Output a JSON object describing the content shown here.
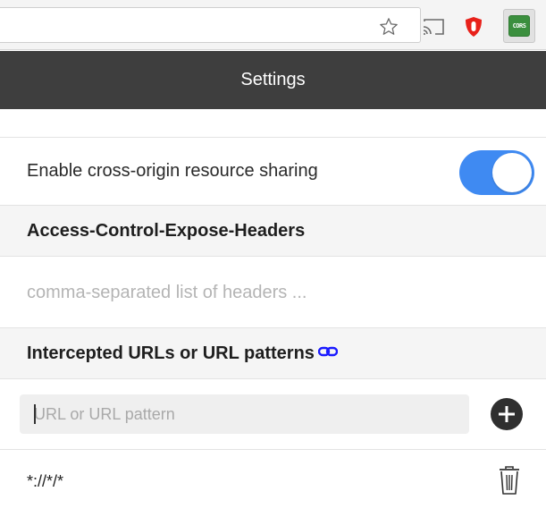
{
  "toolbar": {
    "icons": [
      "star-icon",
      "cast-icon",
      "ublock-icon",
      "cors-extension-icon"
    ],
    "cors_badge_text": "CORS",
    "cors_badge_color": "#3b8f3e"
  },
  "header": {
    "title": "Settings",
    "background": "#3e3e3e"
  },
  "cors_toggle": {
    "label": "Enable cross-origin resource sharing",
    "enabled": true,
    "color": "#3f8af2"
  },
  "expose_headers": {
    "title": "Access-Control-Expose-Headers",
    "value": "",
    "placeholder": "comma-separated list of headers ..."
  },
  "intercepted_urls": {
    "title": "Intercepted URLs or URL patterns",
    "title_icon": "link-icon",
    "input_value": "",
    "input_placeholder": "URL or URL pattern",
    "add_icon": "plus-circle-icon",
    "items": [
      {
        "pattern": "*://*/*",
        "delete_icon": "trash-icon"
      }
    ]
  }
}
